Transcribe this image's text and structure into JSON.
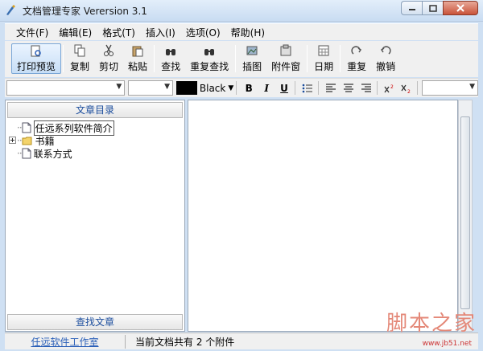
{
  "window": {
    "title": "文档管理专家 Verersion 3.1"
  },
  "menu": [
    "文件(F)",
    "编辑(E)",
    "格式(T)",
    "插入(I)",
    "选项(O)",
    "帮助(H)"
  ],
  "toolbar": [
    {
      "label": "打印预览",
      "icon": "print-preview-icon"
    },
    {
      "label": "复制",
      "icon": "copy-icon"
    },
    {
      "label": "剪切",
      "icon": "cut-icon"
    },
    {
      "label": "粘贴",
      "icon": "paste-icon"
    },
    {
      "label": "查找",
      "icon": "find-icon"
    },
    {
      "label": "重复查找",
      "icon": "find-again-icon"
    },
    {
      "label": "插图",
      "icon": "insert-image-icon"
    },
    {
      "label": "附件窗",
      "icon": "attachment-icon"
    },
    {
      "label": "日期",
      "icon": "calendar-icon"
    },
    {
      "label": "重复",
      "icon": "redo-icon"
    },
    {
      "label": "撤销",
      "icon": "undo-icon"
    }
  ],
  "format": {
    "color_name": "Black",
    "bold": "B",
    "italic": "I",
    "underline": "U"
  },
  "left_panel": {
    "header": "文章目录",
    "footer": "查找文章",
    "tree": [
      {
        "label": "任远系列软件简介",
        "type": "doc",
        "selected": true
      },
      {
        "label": "书籍",
        "type": "folder",
        "expander": "+"
      },
      {
        "label": "联系方式",
        "type": "doc"
      }
    ]
  },
  "status": {
    "link": "任远软件工作室",
    "text": "当前文档共有 2 个附件"
  },
  "watermark": {
    "text": "脚本之家",
    "url": "www.jb51.net"
  }
}
